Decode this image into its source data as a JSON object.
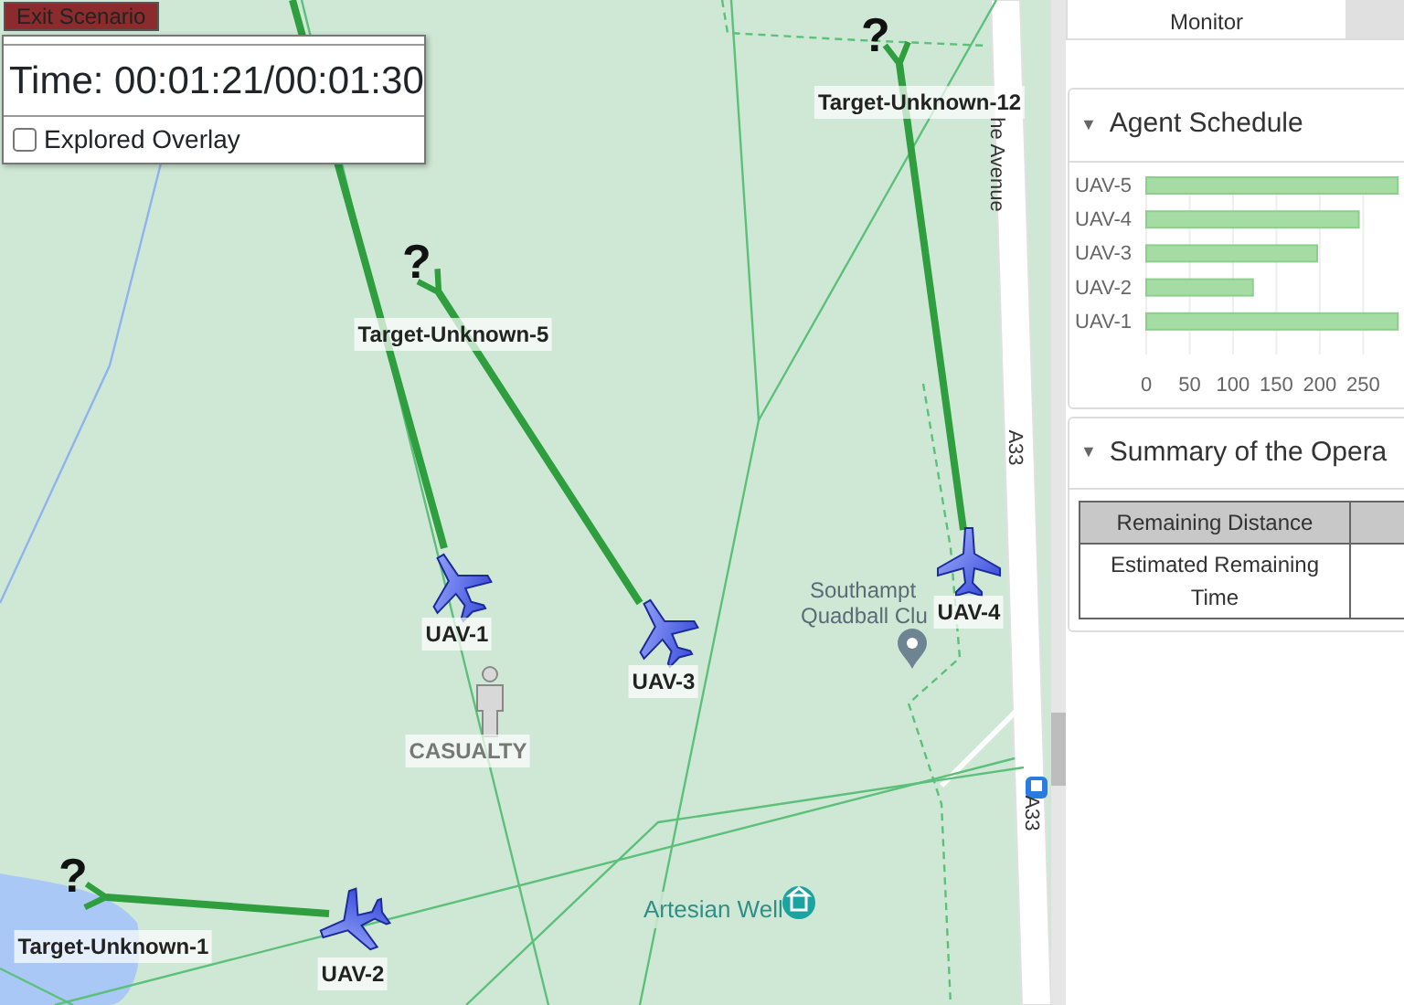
{
  "controls": {
    "exit_button": "Exit Scenario",
    "time": "Time: 00:01:21/00:01:30",
    "overlay": {
      "label": "Explored Overlay",
      "checked": false
    }
  },
  "map": {
    "agents": [
      {
        "name": "UAV-1"
      },
      {
        "name": "UAV-2"
      },
      {
        "name": "UAV-3"
      },
      {
        "name": "UAV-4"
      }
    ],
    "targets": [
      {
        "name": "Target-Unknown-12",
        "marker": "?"
      },
      {
        "name": "Target-Unknown-5",
        "marker": "?"
      },
      {
        "name": "Target-Unknown-1",
        "marker": "?"
      }
    ],
    "casualties": [
      {
        "label": "CASUALTY"
      }
    ],
    "place_labels": [
      {
        "kind": "road",
        "text": "he Avenue"
      },
      {
        "kind": "road",
        "text": "A33"
      },
      {
        "kind": "road",
        "text": "A33"
      },
      {
        "kind": "poi",
        "text": "Southampt"
      },
      {
        "kind": "poi",
        "text": "Quadball Clu"
      },
      {
        "kind": "water",
        "text": "Artesian Well"
      }
    ]
  },
  "tabs": [
    {
      "label": "Monitor",
      "selected": true
    }
  ],
  "agent_schedule": {
    "title": "Agent Schedule",
    "caret": "▼",
    "expanded": true,
    "chart_data": {
      "type": "bar",
      "orientation": "horizontal",
      "grid": true,
      "categories": [
        "UAV-5",
        "UAV-4",
        "UAV-3",
        "UAV-2",
        "UAV-1"
      ],
      "values": [
        290,
        245,
        197,
        123,
        290
      ],
      "xlim": [
        0,
        295
      ],
      "xticks": [
        0,
        50,
        100,
        150,
        200,
        250
      ]
    }
  },
  "summary": {
    "title": "Summary of the Opera",
    "caret": "▼",
    "expanded": true,
    "rows": [
      "Remaining Distance",
      "Estimated Remaining Time"
    ]
  }
}
